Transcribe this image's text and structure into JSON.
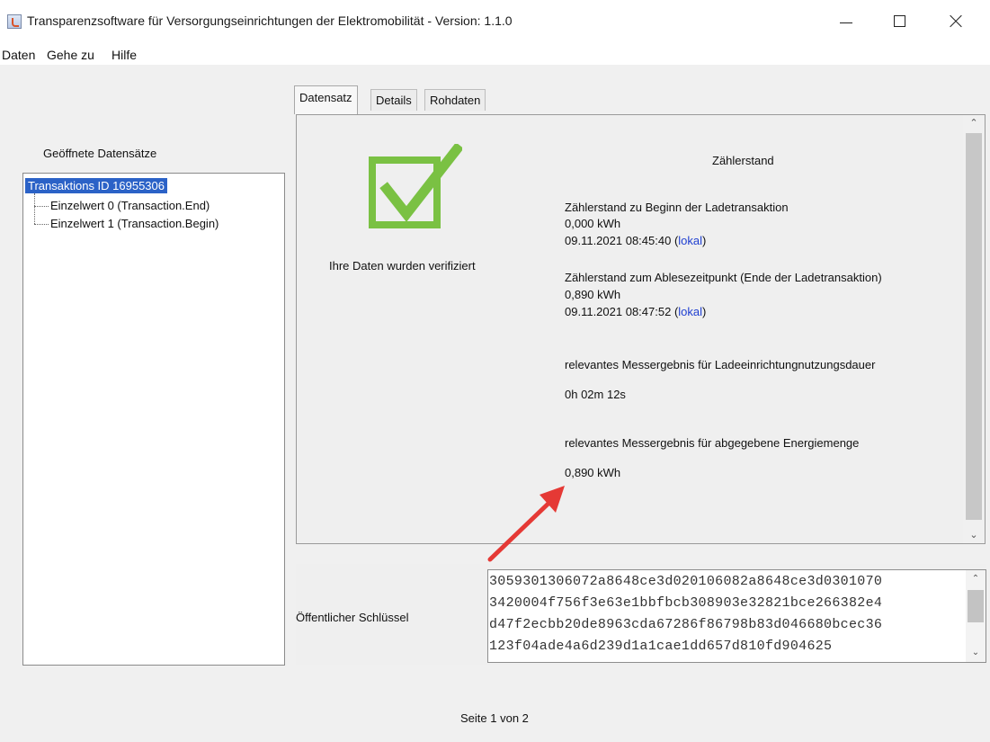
{
  "window": {
    "title": "Transparenzsoftware für Versorgungseinrichtungen der Elektromobilität - Version: 1.1.0"
  },
  "menu": {
    "items": [
      "Daten",
      "Gehe zu",
      "Hilfe"
    ]
  },
  "tree": {
    "label": "Geöffnete Datensätze",
    "root": "Transaktions ID 16955306",
    "children": [
      "Einzelwert 0 (Transaction.End)",
      "Einzelwert 1 (Transaction.Begin)"
    ]
  },
  "tabs": [
    "Datensatz",
    "Details",
    "Rohdaten"
  ],
  "verification": {
    "icon": "check-icon",
    "color": "#7ac143",
    "text": "Ihre Daten wurden verifiziert"
  },
  "meter": {
    "title": "Zählerstand",
    "begin_label": "Zählerstand zu Beginn der Ladetransaktion",
    "begin_value": "0,000 kWh",
    "begin_time": "09.11.2021 08:45:40",
    "begin_time_link": "lokal",
    "end_label": "Zählerstand zum Ablesezeitpunkt (Ende der Ladetransaktion)",
    "end_value": "0,890 kWh",
    "end_time": "09.11.2021 08:47:52",
    "end_time_link": "lokal",
    "duration_label": "relevantes Messergebnis für Ladeeinrichtungnutzungsdauer",
    "duration_value": "0h 02m 12s",
    "energy_label": "relevantes Messergebnis für abgegebene Energiemenge",
    "energy_value": "0,890 kWh"
  },
  "annotation": {
    "arrow_color": "#e53935"
  },
  "public_key": {
    "label": "Öffentlicher Schlüssel",
    "lines": [
      "3059301306072a8648ce3d020106082a8648ce3d0301070",
      "3420004f756f3e63e1bbfbcb308903e32821bce266382e4",
      "d47f2ecbb20de8963cda67286f86798b83d046680bcec36",
      "123f04ade4a6d239d1a1cae1dd657d810fd904625"
    ]
  },
  "footer": {
    "page_indicator": "Seite 1 von 2"
  }
}
